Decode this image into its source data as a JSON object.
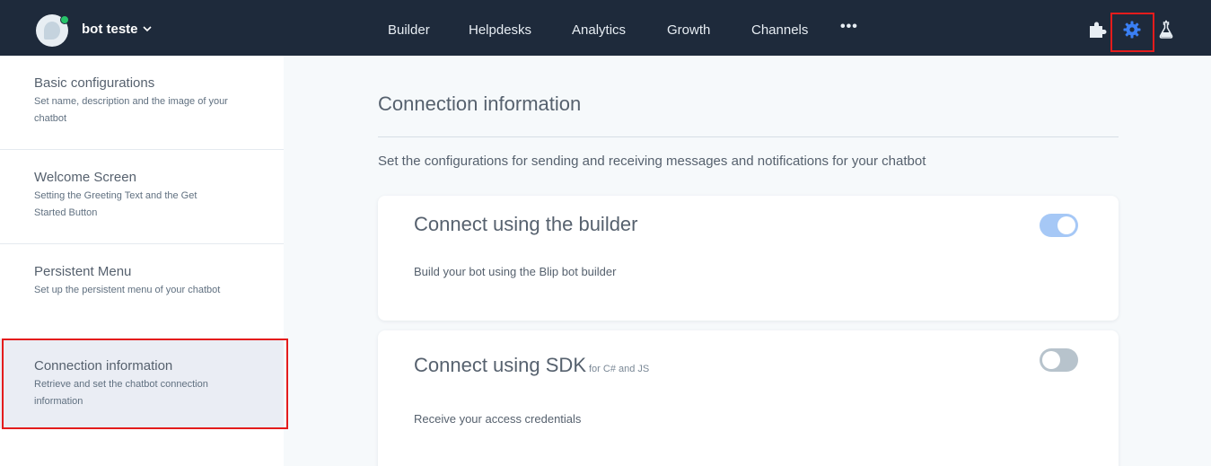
{
  "header": {
    "bot_name": "bot teste",
    "nav": [
      "Builder",
      "Helpdesks",
      "Analytics",
      "Growth",
      "Channels"
    ],
    "more_label": "•••",
    "icons": [
      "puzzle-icon",
      "gear-icon",
      "flask-icon"
    ],
    "active_icon": "gear-icon",
    "colors": {
      "bar": "#1e2a3b",
      "active_icon": "#3a7ff4",
      "online_dot": "#27c46a",
      "highlight": "#e41c1c"
    }
  },
  "sidebar": {
    "items": [
      {
        "title": "Basic configurations",
        "desc": "Set name, description and the image of your chatbot"
      },
      {
        "title": "Welcome Screen",
        "desc": "Setting the Greeting Text and the Get Started Button"
      },
      {
        "title": "Persistent Menu",
        "desc": "Set up the persistent menu of your chatbot"
      },
      {
        "title": "Connection information",
        "desc": "Retrieve and set the chatbot connection information"
      }
    ],
    "selected_index": 3
  },
  "main": {
    "title": "Connection information",
    "description": "Set the configurations for sending and receiving messages and notifications for your chatbot",
    "cards": [
      {
        "title": "Connect using the builder",
        "subtitle": "",
        "desc": "Build your bot using the Blip bot builder",
        "enabled": true
      },
      {
        "title": "Connect using SDK",
        "subtitle": "for C# and JS",
        "desc": "Receive your access credentials",
        "enabled": false
      }
    ]
  }
}
